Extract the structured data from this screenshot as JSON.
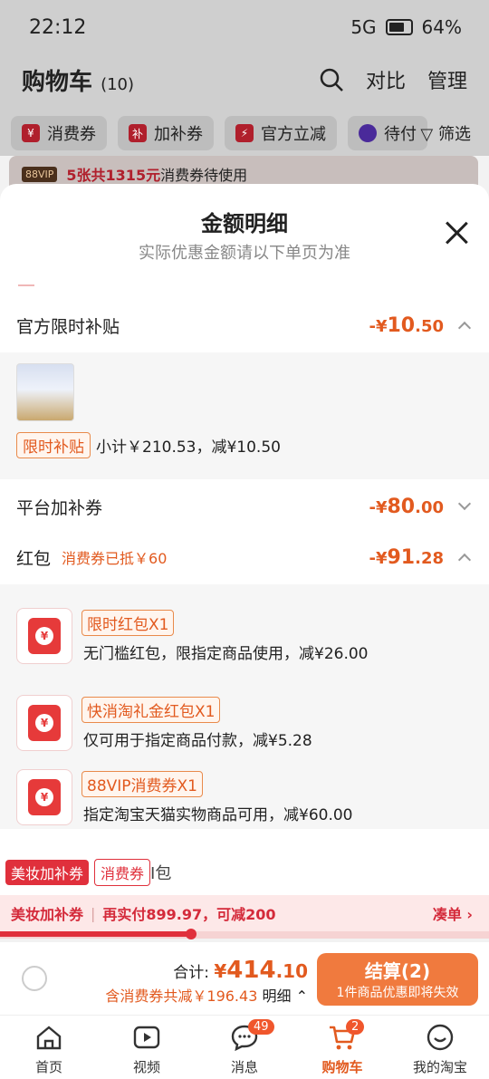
{
  "status": {
    "time": "22:12",
    "network": "5G",
    "battery": "64%"
  },
  "header": {
    "title": "购物车",
    "count": "(10)",
    "compare": "对比",
    "manage": "管理"
  },
  "filters": [
    {
      "label": "消费券"
    },
    {
      "label": "加补券"
    },
    {
      "label": "官方立减"
    },
    {
      "label": "待付"
    }
  ],
  "filter_right": "筛选",
  "vip": {
    "tag": "88VIP",
    "highlight": "5张共1315元",
    "text": "消费券待使用"
  },
  "sheet": {
    "title": "金额明细",
    "subtitle": "实际优惠金额请以下单页为准",
    "sections": {
      "official": {
        "label": "官方限时补贴",
        "amount_prefix": "-¥",
        "amount_int": "10",
        "amount_dec": ".50"
      },
      "product_line": {
        "tag": "限时补贴",
        "text": "小计￥210.53，减¥10.50"
      },
      "platform": {
        "label": "平台加补券",
        "amount_prefix": "-¥",
        "amount_int": "80",
        "amount_dec": ".00"
      },
      "redpacket": {
        "label": "红包",
        "sub": "消费券已抵￥60",
        "amount_prefix": "-¥",
        "amount_int": "91",
        "amount_dec": ".28"
      }
    },
    "coupons": [
      {
        "name": "限时红包X1",
        "desc": "无门槛红包，限指定商品使用，减¥26.00"
      },
      {
        "name": "快消淘礼金红包X1",
        "desc": "仅可用于指定商品付款，减¥5.28"
      },
      {
        "name": "88VIP消费券X1",
        "desc": "指定淘宝天猫实物商品可用，减¥60.00"
      }
    ],
    "peek": {
      "tag1": "美妆加补券",
      "tag2": "消费券",
      "ghost": "I包"
    }
  },
  "promo": {
    "a": "美妆加补券",
    "b": "再实付899.97，可减200",
    "go": "凑单 ›",
    "progress": 0.39
  },
  "checkout": {
    "total_label": "合计:",
    "total_prefix": "¥",
    "total_int": "414",
    "total_dec": ".10",
    "saving": "含消费券共减￥196.43",
    "detail": "明细",
    "button_main": "结算(2)",
    "button_sub": "1件商品优惠即将失效"
  },
  "tabs": [
    {
      "label": "首页",
      "icon": "home-icon"
    },
    {
      "label": "视频",
      "icon": "video-icon"
    },
    {
      "label": "消息",
      "icon": "message-icon",
      "badge": "49"
    },
    {
      "label": "购物车",
      "icon": "cart-icon",
      "badge": "2",
      "active": true
    },
    {
      "label": "我的淘宝",
      "icon": "profile-icon"
    }
  ],
  "colors": {
    "accent": "#e25a1f",
    "brand_red": "#e0303c",
    "checkout": "#f07a3e"
  }
}
